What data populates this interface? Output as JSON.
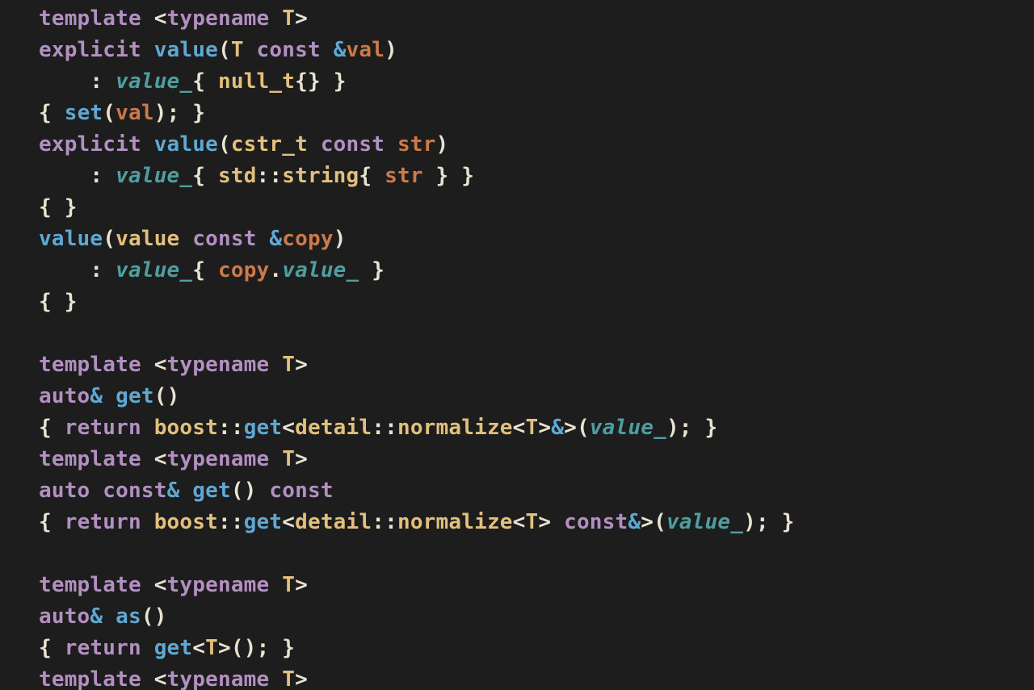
{
  "tokens": {
    "template": "template",
    "typename": "typename",
    "T": "T",
    "explicit": "explicit",
    "value": "value",
    "const": "const",
    "amp": "&",
    "val": "val",
    "value_": "value_",
    "null_t": "null_t",
    "set": "set",
    "cstr_t": "cstr_t",
    "str": "str",
    "std": "std",
    "string": "string",
    "copy": "copy",
    "auto": "auto",
    "get": "get",
    "return": "return",
    "boost": "boost",
    "detail": "detail",
    "normalize": "normalize",
    "as": "as",
    "lt": "<",
    "gt": ">",
    "lparen": "(",
    "rparen": ")",
    "lbrace": "{",
    "rbrace": "}",
    "colon": ":",
    "coloncolon": "::",
    "semi": ";",
    "dot": ".",
    "sp": " ",
    "indent": "    "
  }
}
